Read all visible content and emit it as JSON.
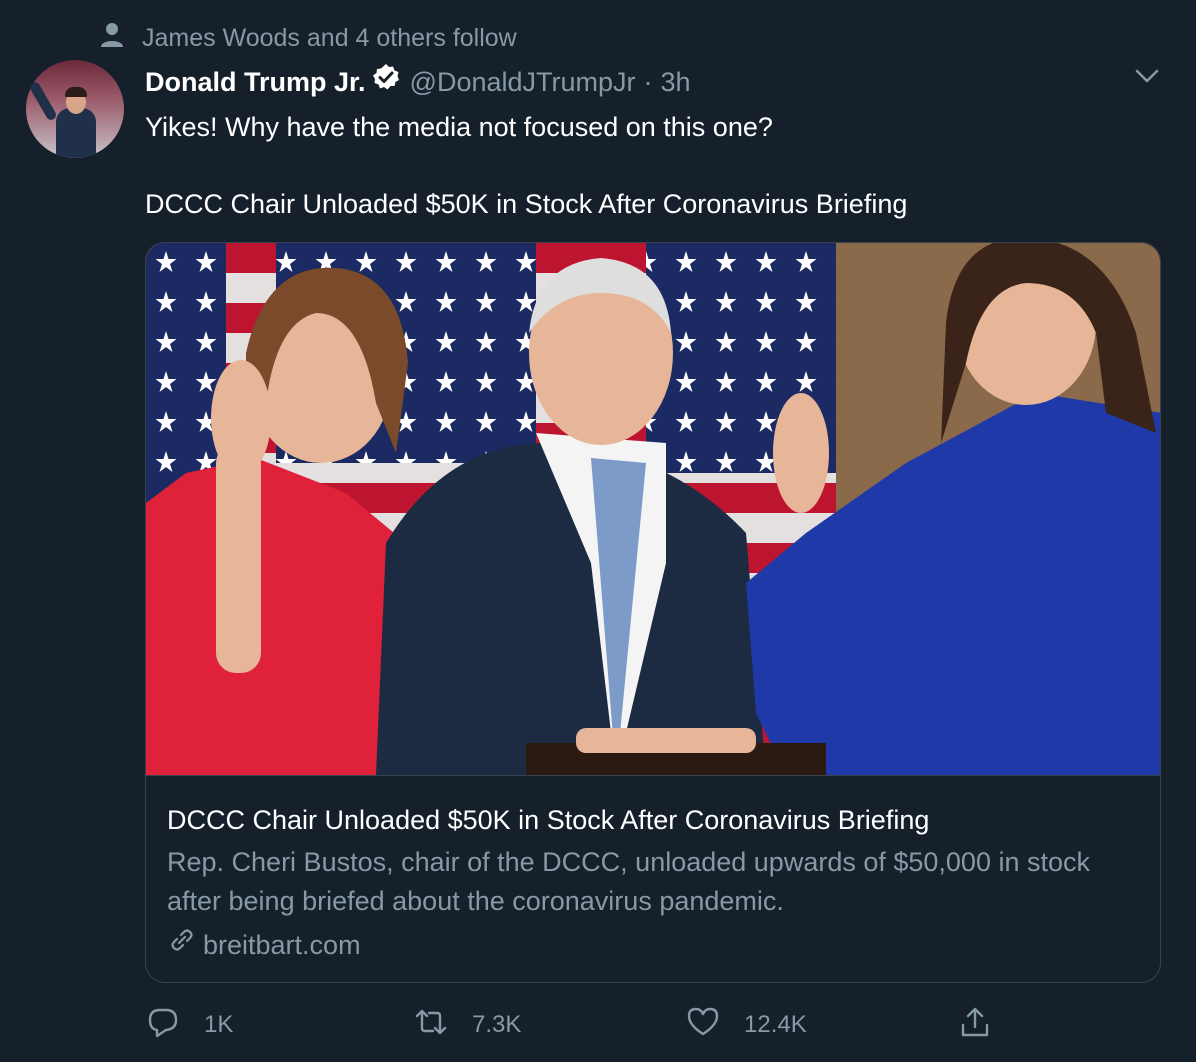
{
  "social_context": {
    "icon": "person-icon",
    "text": "James Woods and 4 others follow"
  },
  "tweet": {
    "display_name": "Donald Trump Jr.",
    "verified_icon": "verified-badge-icon",
    "handle": "@DonaldJTrumpJr",
    "separator": "·",
    "time": "3h",
    "text_line1": "Yikes! Why have the media not focused on this one?",
    "text_line2": "DCCC Chair Unloaded $50K in Stock After Coronavirus Briefing"
  },
  "card": {
    "title": "DCCC Chair Unloaded $50K in Stock After Coronavirus Briefing",
    "description": "Rep. Cheri Bustos, chair of the DCCC, unloaded upwards of $50,000 in stock after being briefed about the coronavirus pandemic.",
    "link_icon": "link-icon",
    "domain": "breitbart.com"
  },
  "actions": {
    "reply": {
      "icon": "reply-icon",
      "count": "1K"
    },
    "retweet": {
      "icon": "retweet-icon",
      "count": "7.3K"
    },
    "like": {
      "icon": "heart-icon",
      "count": "12.4K"
    },
    "share": {
      "icon": "share-icon"
    }
  },
  "colors": {
    "background": "#15202b",
    "secondary_text": "#8899a6",
    "border": "#38444d",
    "verified": "#ffffff"
  }
}
